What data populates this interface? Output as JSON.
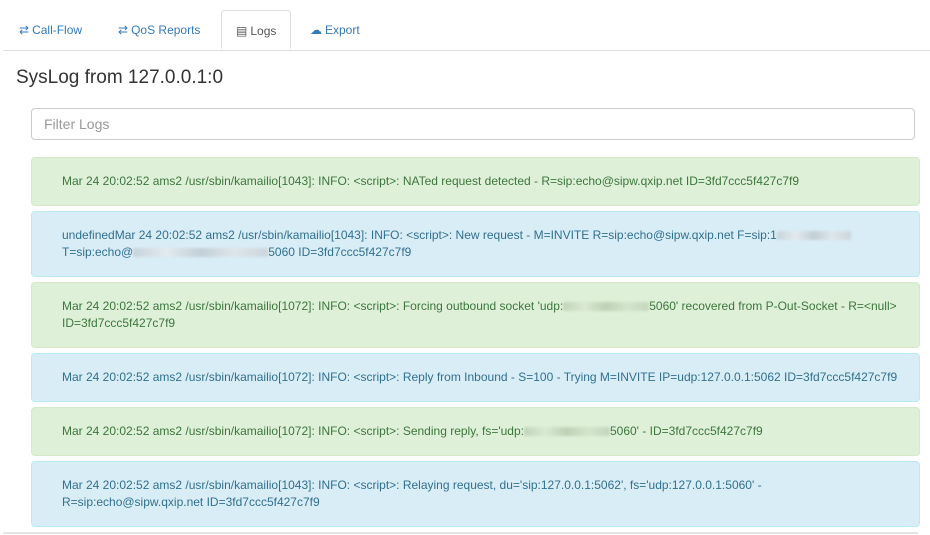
{
  "tabs": [
    {
      "label": "Call-Flow",
      "icon": "exchange-icon",
      "glyph": "⇄",
      "active": false
    },
    {
      "label": "QoS Reports",
      "icon": "exchange-icon",
      "glyph": "⇄",
      "active": false
    },
    {
      "label": "Logs",
      "icon": "file-text-icon",
      "glyph": "▤",
      "active": true
    },
    {
      "label": "Export",
      "icon": "cloud-icon",
      "glyph": "☁",
      "active": false
    }
  ],
  "page_title": "SysLog from 127.0.0.1:0",
  "filter": {
    "placeholder": "Filter Logs",
    "value": ""
  },
  "logs": [
    {
      "style": "success",
      "line1_a": "Mar 24 20:02:52 ams2 /usr/sbin/kamailio[1043]: INFO: <script>: NATed request detected - R=sip:echo@sipw.qxip.net ID=3fd7ccc5f427c7f9",
      "line1_b": "",
      "line2_a": "",
      "line2_b": ""
    },
    {
      "style": "info",
      "line1_a": "undefinedMar 24 20:02:52 ams2 /usr/sbin/kamailio[1043]: INFO: <script>: New request - M=INVITE R=sip:echo@sipw.qxip.net F=sip:1",
      "line1_b": "",
      "line2_a": "T=sip:echo@",
      "line2_b": "5060 ID=3fd7ccc5f427c7f9"
    },
    {
      "style": "success",
      "line1_a": "Mar 24 20:02:52 ams2 /usr/sbin/kamailio[1072]: INFO: <script>: Forcing outbound socket 'udp:",
      "line1_b": "5060' recovered from P-Out-Socket - R=<null>",
      "line2_a": "ID=3fd7ccc5f427c7f9",
      "line2_b": ""
    },
    {
      "style": "info",
      "line1_a": "Mar 24 20:02:52 ams2 /usr/sbin/kamailio[1072]: INFO: <script>: Reply from Inbound - S=100 - Trying M=INVITE IP=udp:127.0.0.1:5062 ID=3fd7ccc5f427c7f9",
      "line1_b": "",
      "line2_a": "",
      "line2_b": ""
    },
    {
      "style": "success",
      "line1_a": "Mar 24 20:02:52 ams2 /usr/sbin/kamailio[1072]: INFO: <script>: Sending reply, fs='udp:",
      "line1_b": "5060' - ID=3fd7ccc5f427c7f9",
      "line2_a": "",
      "line2_b": ""
    },
    {
      "style": "info",
      "line1_a": "Mar 24 20:02:52 ams2 /usr/sbin/kamailio[1043]: INFO: <script>: Relaying request, du='sip:127.0.0.1:5062', fs='udp:127.0.0.1:5060' -",
      "line1_b": "",
      "line2_a": "R=sip:echo@sipw.qxip.net ID=3fd7ccc5f427c7f9",
      "line2_b": ""
    }
  ]
}
